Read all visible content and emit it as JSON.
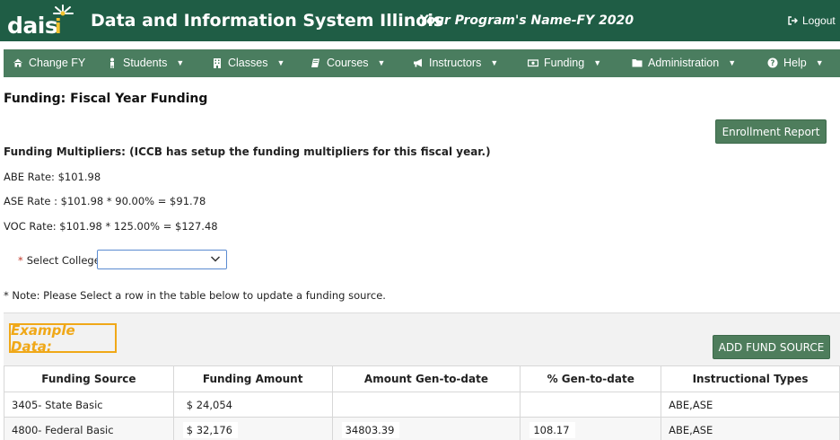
{
  "header": {
    "logo_text": "dais",
    "logo_i": "i",
    "app_title": "Data and Information System Illinois",
    "program_name": "Your Program's Name-FY 2020",
    "logout_label": "Logout",
    "logout_icon": "sign-out-icon"
  },
  "nav": {
    "items": [
      {
        "label": "Change FY",
        "icon": "home-icon",
        "dropdown": false
      },
      {
        "label": "Students",
        "icon": "student-icon",
        "dropdown": true
      },
      {
        "label": "Classes",
        "icon": "building-icon",
        "dropdown": true
      },
      {
        "label": "Courses",
        "icon": "book-icon",
        "dropdown": true
      },
      {
        "label": "Instructors",
        "icon": "bullhorn-icon",
        "dropdown": true
      },
      {
        "label": "Funding",
        "icon": "money-icon",
        "dropdown": true
      },
      {
        "label": "Administration",
        "icon": "folder-icon",
        "dropdown": true
      },
      {
        "label": "Help",
        "icon": "question-icon",
        "dropdown": true
      }
    ]
  },
  "page": {
    "title": "Funding: Fiscal Year Funding",
    "enrollment_report_label": "Enrollment Report",
    "multipliers_heading": "Funding Multipliers: (ICCB has setup the funding multipliers for this fiscal year.)",
    "rates": [
      "ABE Rate: $101.98",
      "ASE Rate : $101.98 * 90.00% = $91.78",
      "VOC Rate: $101.98 * 125.00% = $127.48"
    ],
    "select_college": {
      "required_marker": "*",
      "label": "Select College",
      "value": ""
    },
    "note": "* Note: Please Select a row in the table below to update a funding source."
  },
  "table": {
    "example_label": "Example Data:",
    "add_button_label": "ADD FUND SOURCE",
    "columns": [
      "Funding Source",
      "Funding Amount",
      "Amount Gen-to-date",
      "% Gen-to-date",
      "Instructional Types"
    ],
    "rows": [
      [
        "3405- State Basic",
        "$ 24,054",
        "",
        "",
        "ABE,ASE"
      ],
      [
        "4800- Federal Basic",
        "$ 32,176",
        "34803.39",
        "108.17",
        "ABE,ASE"
      ]
    ]
  },
  "colors": {
    "header_bg": "#1f5d45",
    "nav_bg": "#4a7d5f",
    "button_bg": "#4e7d5c",
    "example_accent": "#f0a818",
    "required": "#c0392b"
  }
}
